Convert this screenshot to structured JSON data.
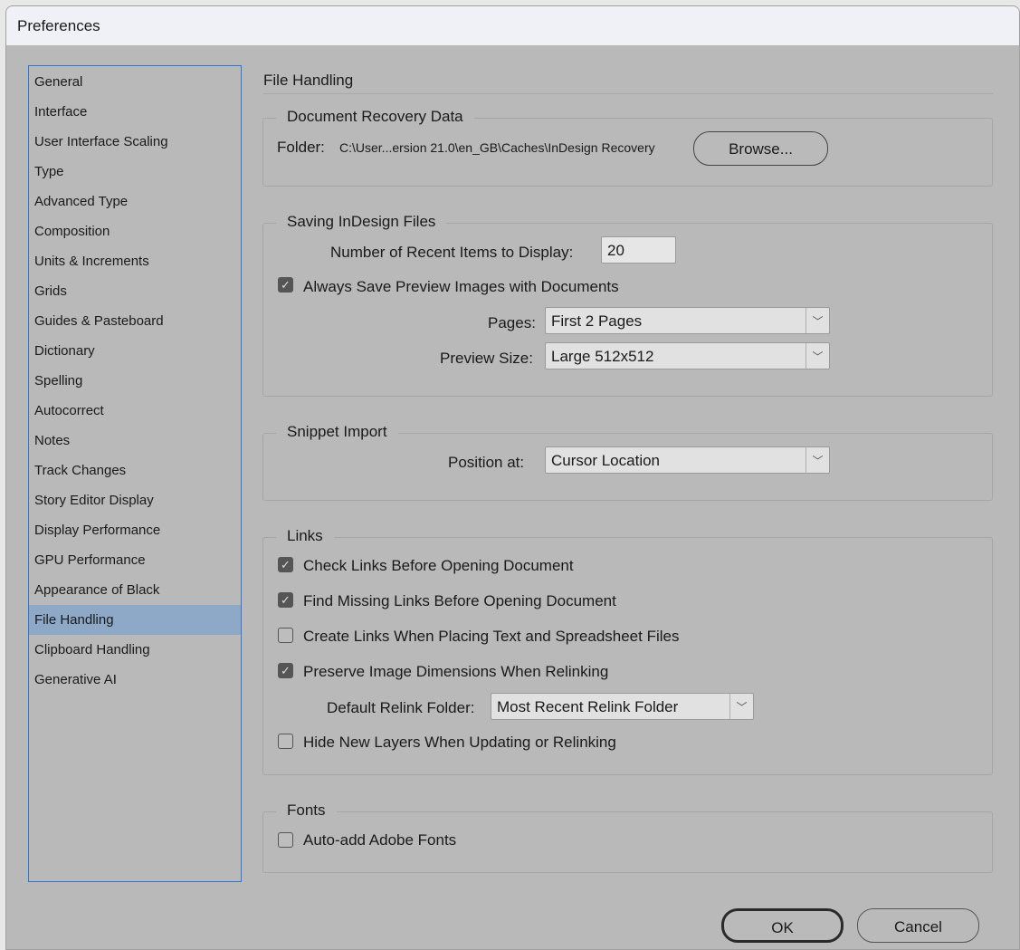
{
  "window": {
    "title": "Preferences"
  },
  "sidebar": {
    "items": [
      "General",
      "Interface",
      "User Interface Scaling",
      "Type",
      "Advanced Type",
      "Composition",
      "Units & Increments",
      "Grids",
      "Guides & Pasteboard",
      "Dictionary",
      "Spelling",
      "Autocorrect",
      "Notes",
      "Track Changes",
      "Story Editor Display",
      "Display Performance",
      "GPU Performance",
      "Appearance of Black",
      "File Handling",
      "Clipboard Handling",
      "Generative AI"
    ],
    "selected": "File Handling"
  },
  "page": {
    "title": "File Handling"
  },
  "recovery": {
    "legend": "Document Recovery Data",
    "folder_label": "Folder:",
    "folder_path": "C:\\User...ersion 21.0\\en_GB\\Caches\\InDesign Recovery",
    "browse": "Browse..."
  },
  "saving": {
    "legend": "Saving InDesign Files",
    "recent_label": "Number of Recent Items to Display:",
    "recent_value": "20",
    "preview_cb": "Always Save Preview Images with Documents",
    "pages_label": "Pages:",
    "pages_value": "First 2 Pages",
    "size_label": "Preview Size:",
    "size_value": "Large 512x512"
  },
  "snippet": {
    "legend": "Snippet Import",
    "position_label": "Position at:",
    "position_value": "Cursor Location"
  },
  "links": {
    "legend": "Links",
    "check": "Check Links Before Opening Document",
    "find": "Find Missing Links Before Opening Document",
    "create": "Create Links When Placing Text and Spreadsheet Files",
    "preserve": "Preserve Image Dimensions When Relinking",
    "relink_label": "Default Relink Folder:",
    "relink_value": "Most Recent Relink Folder",
    "hide": "Hide New Layers When Updating or Relinking"
  },
  "fonts": {
    "legend": "Fonts",
    "auto": "Auto-add Adobe Fonts"
  },
  "buttons": {
    "ok": "OK",
    "cancel": "Cancel"
  }
}
